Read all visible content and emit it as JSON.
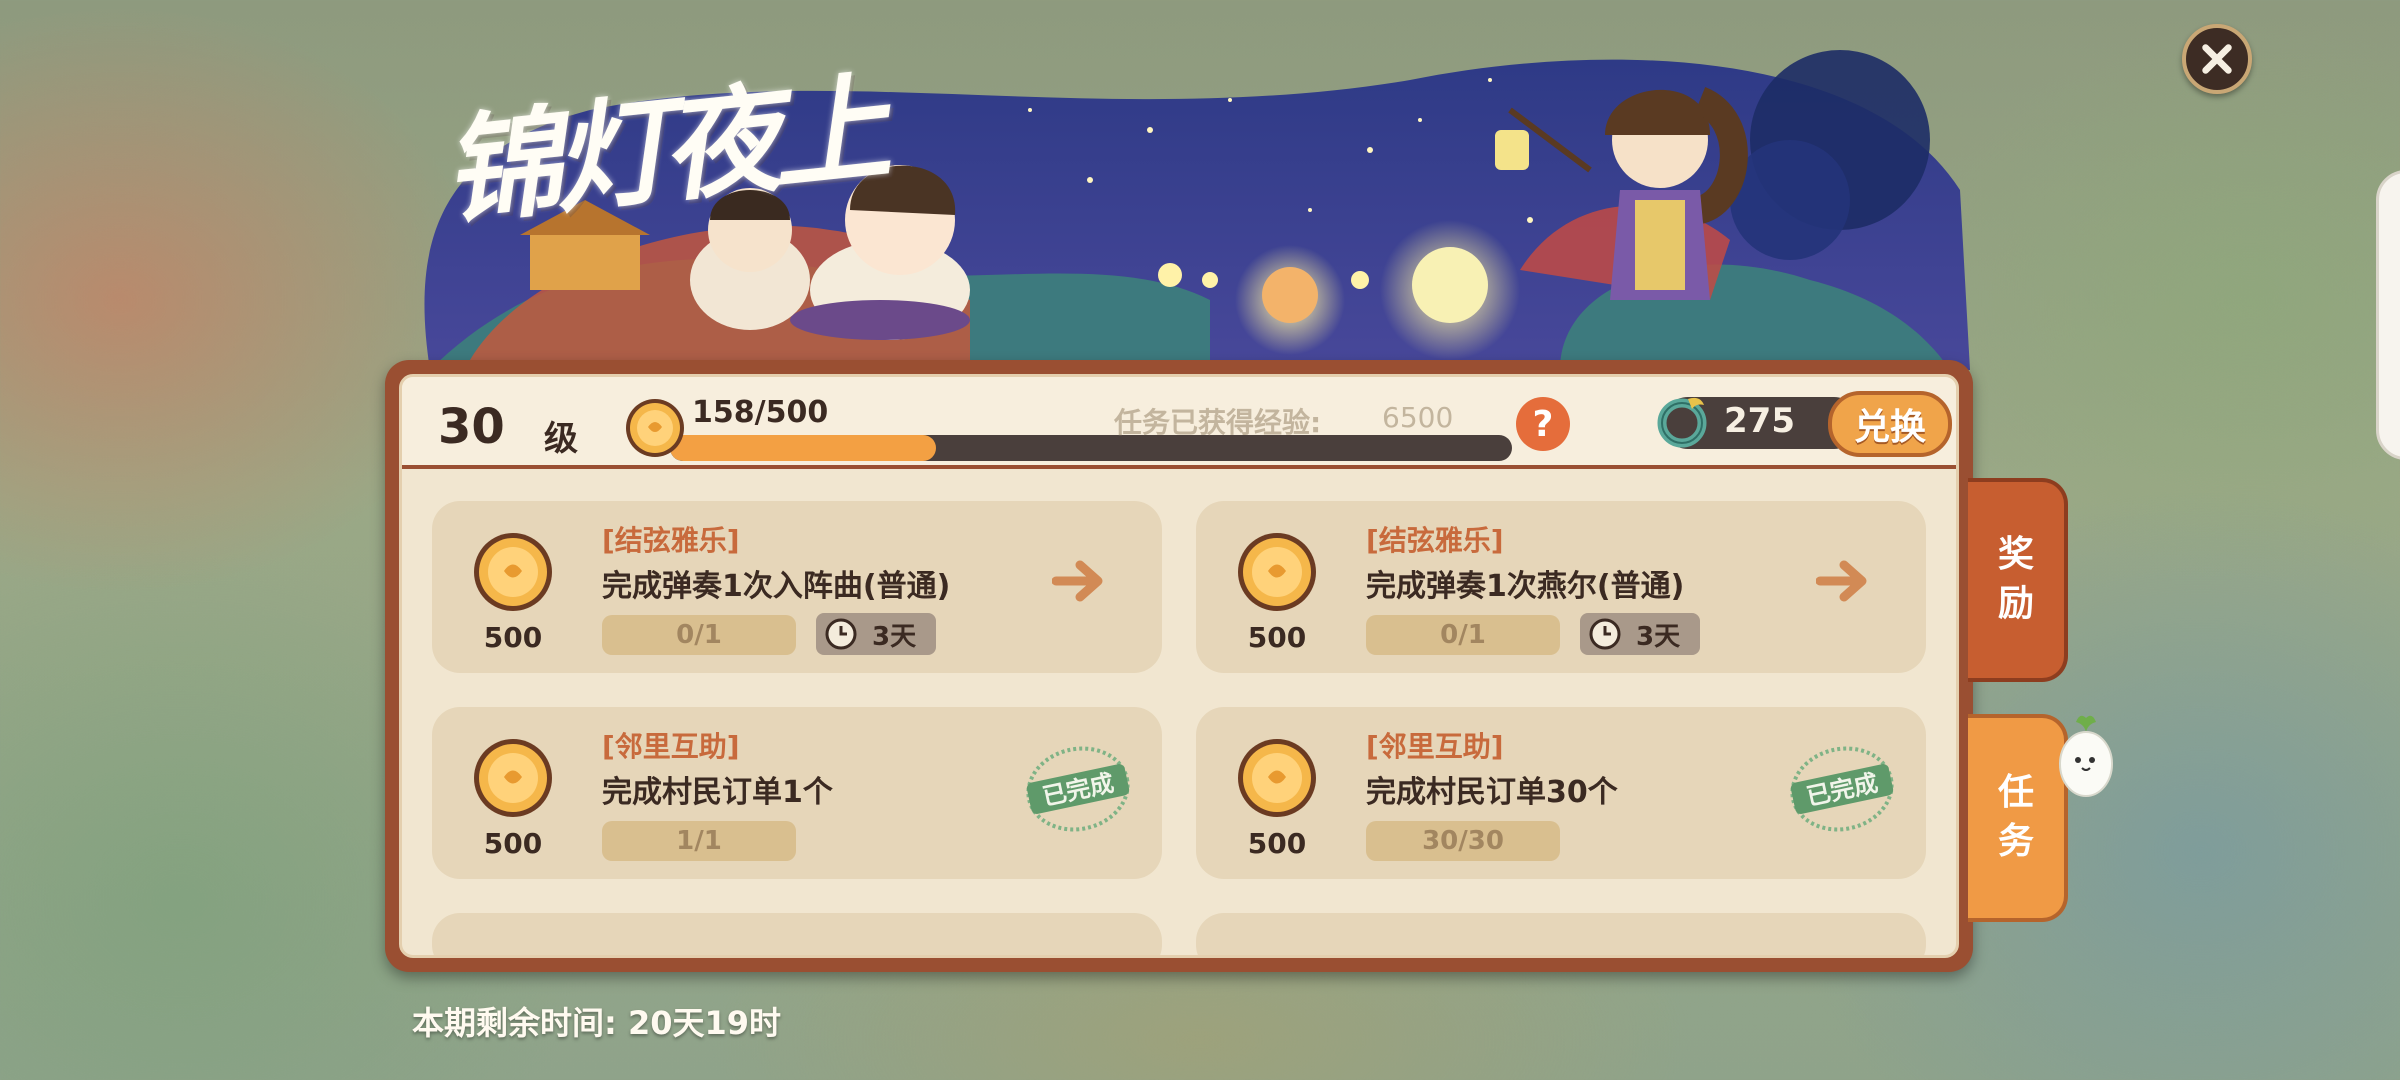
{
  "event_title": "锦灯夜上",
  "header": {
    "level_number": "30",
    "level_unit": "级",
    "xp_current": 158,
    "xp_max": 500,
    "xp_text": "158/500",
    "task_xp_label": "任务已获得经验:",
    "task_xp_value": "6500",
    "help_label": "?",
    "currency_value": "275",
    "exchange_label": "兑换"
  },
  "tasks": [
    {
      "category": "[结弦雅乐]",
      "description": "完成弹奏1次入阵曲(普通)",
      "reward": "500",
      "progress": "0/1",
      "time_left": "3天",
      "status": "in_progress"
    },
    {
      "category": "[结弦雅乐]",
      "description": "完成弹奏1次燕尔(普通)",
      "reward": "500",
      "progress": "0/1",
      "time_left": "3天",
      "status": "in_progress"
    },
    {
      "category": "[邻里互助]",
      "description": "完成村民订单1个",
      "reward": "500",
      "progress": "1/1",
      "status": "completed",
      "stamp_label": "已完成"
    },
    {
      "category": "[邻里互助]",
      "description": "完成村民订单30个",
      "reward": "500",
      "progress": "30/30",
      "status": "completed",
      "stamp_label": "已完成"
    }
  ],
  "tabs": {
    "reward_line1": "奖",
    "reward_line2": "励",
    "task_line1": "任",
    "task_line2": "务"
  },
  "footer": {
    "time_left": "本期剩余时间: 20天19时"
  },
  "colors": {
    "panel_border": "#9a4f32",
    "panel_bg": "#f1e6d0",
    "accent_orange": "#f09a45",
    "category_text": "#c86a3c",
    "stamp_green": "#5f9a6a"
  },
  "icons": [
    "close-icon",
    "xp-coin-icon",
    "help-icon",
    "currency-icon",
    "coin-icon",
    "clock-icon",
    "arrow-right-icon",
    "completed-stamp-icon",
    "radish-mascot-icon"
  ]
}
